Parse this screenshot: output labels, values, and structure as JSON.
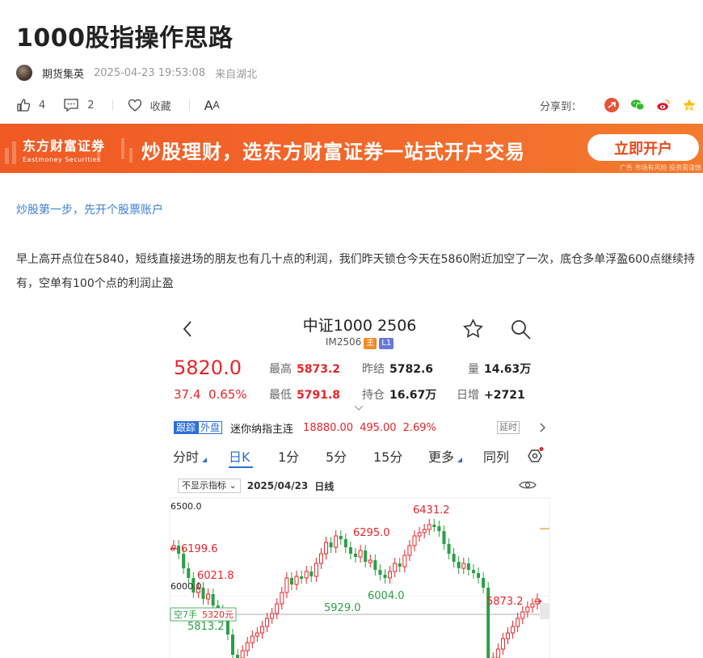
{
  "article": {
    "title": "1000股指操作思路",
    "author": "期货集英",
    "datetime": "2025-04-23 19:53:08",
    "location": "来自湖北"
  },
  "actions": {
    "likes": "4",
    "comments": "2",
    "favorite_label": "收藏",
    "font_size_label": "A",
    "font_size_label_small": "A",
    "share_label": "分享到："
  },
  "banner": {
    "logo_cn": "东方财富证券",
    "logo_en": "Eastmoney Securities",
    "slogan": "炒股理财，选东方财富证券一站式开户交易",
    "button": "立即开户",
    "ad_note": "广告 市场有风险 投资需谨慎"
  },
  "body": {
    "link_text": "炒股第一步，先开个股票账户",
    "paragraph": "早上高开点位在5840，短线直接进场的朋友也有几十点的利润，我们昨天锁仓今天在5860附近加空了一次，底仓多单浮盈600点继续持有，空单有100个点的利润止盈"
  },
  "app": {
    "title": "中证1000 2506",
    "code": "IM2506",
    "tag_main": "主",
    "tag_l1": "L1",
    "price": "5820.0",
    "change": "37.4",
    "change_pct": "0.65%",
    "high_label": "最高",
    "high": "5873.2",
    "low_label": "最低",
    "low": "5791.8",
    "prev_label": "昨结",
    "prev": "5782.6",
    "oi_label": "持仓",
    "oi": "16.67万",
    "vol_label": "量",
    "vol": "14.63万",
    "daily_add_label": "日增",
    "daily_add": "+2721",
    "follow_tag1": "跟踪",
    "follow_tag2": "外盘",
    "follow_name": "迷你纳指主连",
    "follow_price": "18880.00",
    "follow_chg": "495.00",
    "follow_pct": "2.69%",
    "follow_delay": "延时",
    "tabs": [
      "分时",
      "日K",
      "1分",
      "5分",
      "15分",
      "更多",
      "同列"
    ],
    "indicator_label": "不显示指标",
    "chart_date": "2025/04/23",
    "chart_period": "日线",
    "position_label": "空7手",
    "position_price": "5320元"
  },
  "chart_data": {
    "type": "candlestick",
    "y_axis_ticks": [
      "6500.0",
      "6000.0"
    ],
    "annotations": [
      "6431.2",
      "6295.0",
      "6199.6",
      "6021.8",
      "6004.0",
      "5929.0",
      "5873.2",
      "5813.2"
    ],
    "colors": {
      "up": "#e5252a",
      "down": "#2b9f45"
    }
  }
}
